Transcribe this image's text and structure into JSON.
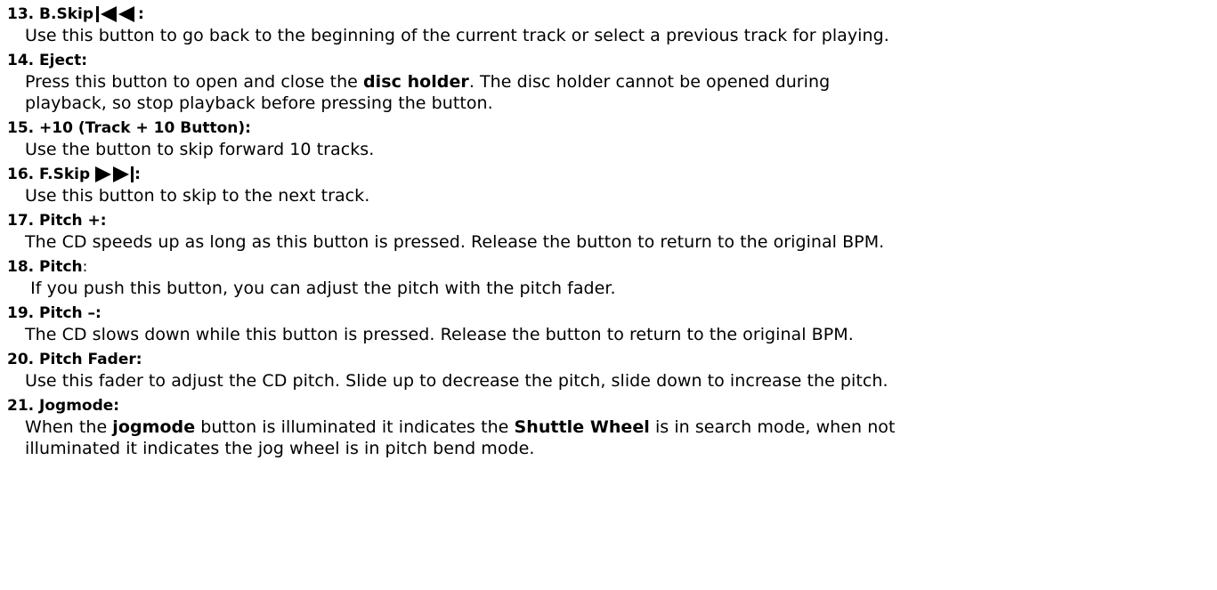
{
  "entries": [
    {
      "number": "13.",
      "title": "B.Skip",
      "title_suffix": ":",
      "icon": "skip-back-icon",
      "body": [
        "Use this button to go back to the beginning of the current track or select a previous track for playing."
      ]
    },
    {
      "number": "14.",
      "title": "Eject:",
      "body_parts": {
        "a": "Press this button to open and close the ",
        "b_bold": "disc holder",
        "c": ". The disc holder cannot be opened during",
        "line2": "playback, so stop playback before pressing the button."
      }
    },
    {
      "number": "15.",
      "title": "+10 (Track + 10 Button):",
      "body": [
        "Use the button to skip forward 10 tracks."
      ]
    },
    {
      "number": "16.",
      "title": "F.Skip",
      "title_suffix": ":",
      "icon": "skip-forward-icon",
      "body": [
        "Use this button to skip to the next track."
      ]
    },
    {
      "number": "17.",
      "title": "Pitch +:",
      "body": [
        "The CD speeds up as long as this button is pressed. Release the button to return to the original BPM."
      ]
    },
    {
      "number": "18.",
      "title": "Pitch",
      "title_suffix": ":",
      "body": [
        " If you push this button, you can adjust the pitch with the pitch fader."
      ]
    },
    {
      "number": "19.",
      "title": "Pitch –:",
      "body": [
        "The CD slows down while this button is pressed. Release the button to return to the original BPM."
      ]
    },
    {
      "number": "20.",
      "title": "Pitch Fader:",
      "body": [
        "Use this fader to adjust the CD pitch. Slide up to decrease the pitch, slide down to increase the pitch."
      ]
    },
    {
      "number": "21.",
      "title": "Jogmode:",
      "body_parts": {
        "a": "When the ",
        "b_bold": "jogmode",
        "c": " button is illuminated it indicates the ",
        "d_bold": "Shuttle Wheel",
        "e": " is in search mode, when not",
        "line2": "illuminated it indicates the jog wheel is in pitch bend mode."
      }
    }
  ],
  "colors": {
    "text": "#000000",
    "background": "#ffffff"
  }
}
